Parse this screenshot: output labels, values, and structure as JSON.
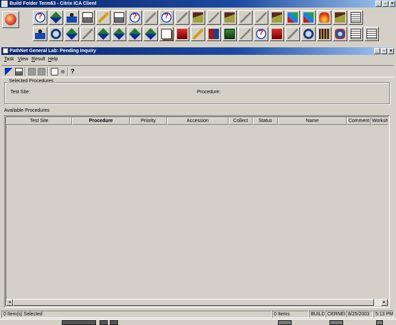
{
  "window": {
    "title": "Build Folder Term63 - Citrix ICA Client",
    "controls": {
      "minimize": "_",
      "restore": "▫",
      "close": "×"
    }
  },
  "toolbar": {
    "main_icon": "app-launcher-icon",
    "row1": [
      "help-icon",
      "diamond-icon",
      "person-card-icon",
      "print-icon",
      "pen-icon",
      "printer-icon",
      "help-icon",
      "key-icon",
      "help-icon",
      "key-icon",
      "house-icon",
      "wrench-icon",
      "house-icon",
      "key-icon",
      "key-icon",
      "house-icon",
      "cube-icon",
      "cube-icon",
      "fire-icon",
      "house-icon",
      "notes-icon"
    ],
    "row2": [
      "person-icon",
      "magnifier-icon",
      "diamond-icon",
      "wrench-icon",
      "diamond-icon",
      "diamond-icon",
      "diamond-icon",
      "diamond-icon",
      "document-icon",
      "red-box-icon",
      "hammer-icon",
      "books-icon",
      "green-box-icon",
      "wrench-icon",
      "help-icon",
      "flag-icon",
      "wrench-icon",
      "magnifier-icon",
      "film-icon",
      "speaker-icon",
      "stack-icon",
      "notes-icon"
    ]
  },
  "child_window": {
    "title": "PathNet General Lab: Pending Inquiry",
    "controls": {
      "minimize": "_",
      "restore": "▫",
      "close": "×"
    }
  },
  "menu": [
    {
      "accel": "T",
      "rest": "ask"
    },
    {
      "accel": "V",
      "rest": "iew"
    },
    {
      "accel": "R",
      "rest": "esult"
    },
    {
      "accel": "H",
      "rest": "elp"
    }
  ],
  "subtoolbar": [
    "pointer-icon",
    "print-icon",
    "disabled-icon",
    "disabled-icon",
    "tools-icon",
    "help-icon"
  ],
  "selected_procedures": {
    "legend": "Selected Procedures",
    "test_site_label": "Test Site:",
    "procedure_label": "Procedure:"
  },
  "available_procedures": {
    "label": "Available Procedures",
    "columns": [
      "Test Site",
      "Procedure",
      "Priority",
      "Accession",
      "Collect",
      "Status",
      "Name",
      "Comment",
      "Workshe"
    ]
  },
  "status_bar": {
    "selected": "0 Item(s) Selected",
    "items": "0 Items",
    "mode": "BUILD",
    "org": "CERNER",
    "date": "8/25/2003",
    "time": "5:13 PM"
  }
}
